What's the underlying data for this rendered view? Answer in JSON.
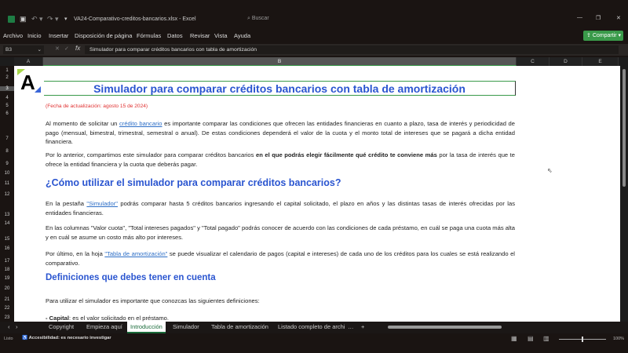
{
  "titlebar": {
    "filename": "VA24-Comparativo-creditos-bancarios.xlsx",
    "app": "Excel",
    "search_placeholder": "Buscar"
  },
  "menu": [
    "Archivo",
    "Inicio",
    "Insertar",
    "Disposición de página",
    "Fórmulas",
    "Datos",
    "Revisar",
    "Vista",
    "Ayuda"
  ],
  "share_label": "Compartir",
  "formula_bar": {
    "cell_ref": "B3",
    "fx": "fx",
    "content": "Simulador para comparar créditos bancarios con tabla de amortización"
  },
  "columns": [
    "A",
    "B",
    "C",
    "D",
    "E"
  ],
  "rows": [
    "1",
    "2",
    "3",
    "4",
    "5",
    "6",
    "7",
    "8",
    "9",
    "10",
    "11",
    "12",
    "13",
    "14",
    "15",
    "16",
    "17",
    "18",
    "19",
    "20",
    "21",
    "22",
    "23"
  ],
  "doc": {
    "title": "Simulador para comparar créditos bancarios con tabla de amortización",
    "date": "(Fecha de actualización: agosto 15 de 2024)",
    "p1_a": "Al momento de solicitar un ",
    "p1_link": "crédito bancario",
    "p1_b": " es importante comparar las condiciones que ofrecen las entidades financieras en cuanto a plazo, tasa de interés y periodicidad de pago (mensual, bimestral, trimestral, semestral o anual). De estas condiciones dependerá el valor de la cuota y el monto total de intereses que se pagará a dicha entidad financiera.",
    "p2_a": "Por lo anterior, compartimos este simulador para comparar créditos bancarios ",
    "p2_bold": "en el que podrás elegir fácilmente qué crédito te conviene más",
    "p2_b": " por la tasa de interés que te ofrece la entidad financiera y la cuota que deberás pagar.",
    "h2": "¿Cómo utilizar el simulador para comparar créditos bancarios?",
    "p3_a": "En la pestaña ",
    "p3_link": "\"Simulador\"",
    "p3_b": " podrás comparar hasta 5 créditos bancarios ingresando el capital solicitado, el plazo en años y las distintas tasas de interés ofrecidas por las entidades financieras.",
    "p4": "En las columnas \"Valor cuota\", \"Total intereses pagados\" y \"Total pagado\" podrás conocer de acuerdo con las condiciones de cada préstamo, en cuál se paga una cuota más alta y en cuál se asume un costo más alto por intereses.",
    "p5_a": "Por último, en la hoja ",
    "p5_link": "\"Tabla de amortización\"",
    "p5_b": " se puede visualizar el calendario de pagos (capital e intereses) de cada uno de los créditos para los cuales se está realizando el comparativo.",
    "h3": "Definiciones que debes tener en cuenta",
    "p6": "Para utilizar el simulador es importante que conozcas las siguientes definiciones:",
    "p7_bold": "- Capital",
    "p7_b": ": es el valor solicitado en el préstamo."
  },
  "tabs": [
    "Copyright",
    "Empieza aquí",
    "Introducción",
    "Simulador",
    "Tabla de amortización",
    "Listado completo de archi"
  ],
  "active_tab": "Introducción",
  "status": {
    "ready": "Listo",
    "accessibility": "Accesibilidad: es necesario investigar",
    "zoom": "100%"
  },
  "colors": {
    "heading": "#2a55d0",
    "date": "#e03030",
    "share": "#3a9a4a"
  }
}
